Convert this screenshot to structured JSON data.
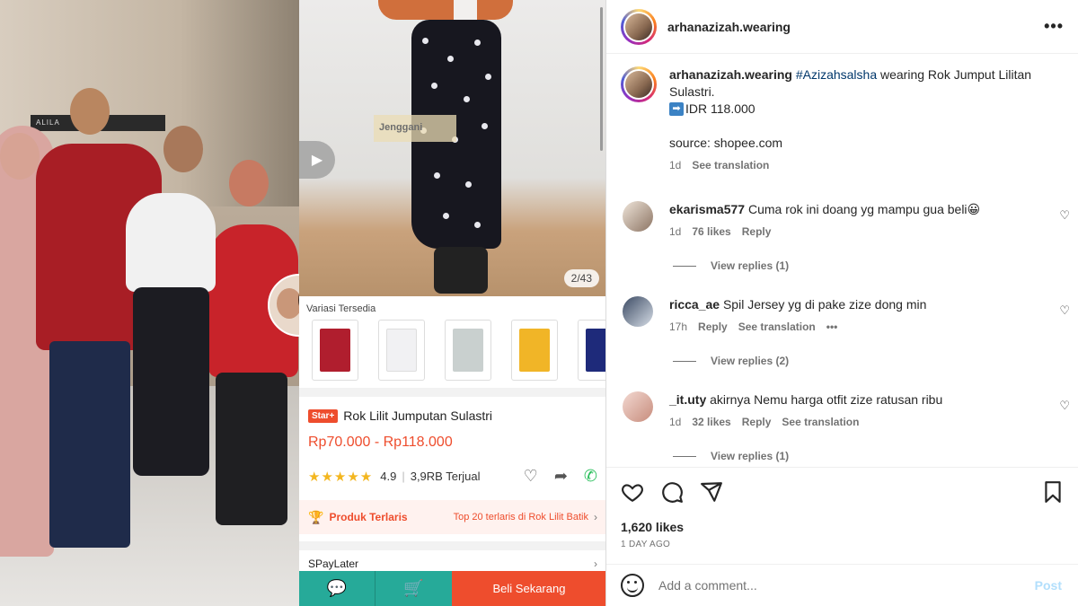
{
  "photo": {
    "sign_text": "ALILA"
  },
  "product": {
    "watermark": "Jenggani",
    "page_counter": "2/43",
    "variant_label": "Variasi Tersedia",
    "variant_colors": [
      "#b01e2e",
      "#f1f1f3",
      "#c9d0cf",
      "#f1b527",
      "#1e2a7a"
    ],
    "badge": "Star+",
    "title": "Rok Lilit Jumputan Sulastri",
    "price": "Rp70.000 - Rp118.000",
    "rating": "4.9",
    "sold": "3,9RB Terjual",
    "best_label": "Produk Terlaris",
    "best_rank": "Top 20 terlaris di Rok Lilit Batik",
    "spaylater": "SPayLater",
    "buy_label": "Beli Sekarang",
    "accent": "#ee4d2d",
    "teal": "#26aa99"
  },
  "post": {
    "username": "arhanazizah.wearing",
    "caption_user": "arhanazizah.wearing",
    "hashtag": "#Azizahsalsha",
    "caption_text": " wearing Rok Jumput Lilitan Sulastri.",
    "price_text": "IDR 118.000",
    "source_text": "source: shopee.com",
    "caption_time": "1d",
    "see_translation": "See translation",
    "likes": "1,620 likes",
    "time_ago": "1 DAY AGO",
    "comment_placeholder": "Add a comment...",
    "post_label": "Post"
  },
  "comments": [
    {
      "user": "ekarisma577",
      "text": "Cuma rok ini doang yg mampu gua beli😀",
      "time": "1d",
      "likes": "76 likes",
      "reply": "Reply",
      "view_replies": "View replies (1)"
    },
    {
      "user": "ricca_ae",
      "text": "Spil Jersey yg di pake zize dong min",
      "time": "17h",
      "reply": "Reply",
      "see_translation": "See translation",
      "more": "•••",
      "view_replies": "View replies (2)"
    },
    {
      "user": "_it.uty",
      "text": "akirnya Nemu harga otfit zize ratusan ribu",
      "time": "1d",
      "likes": "32 likes",
      "reply": "Reply",
      "see_translation": "See translation",
      "view_replies": "View replies (1)"
    }
  ]
}
